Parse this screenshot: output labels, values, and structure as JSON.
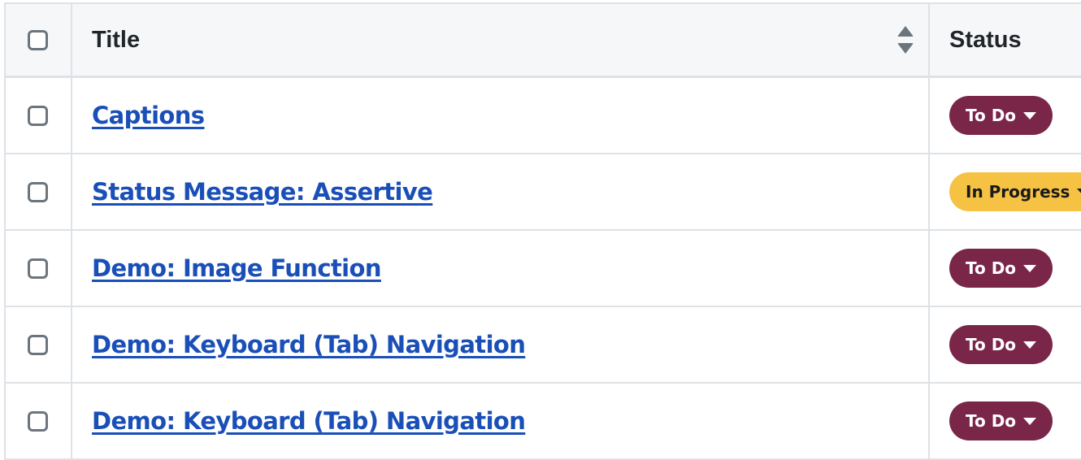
{
  "table": {
    "headers": {
      "select_all": "",
      "title": "Title",
      "status": "Status"
    },
    "sort_icon": "sort-updown-icon",
    "rows": [
      {
        "title": "Captions",
        "status": "To Do",
        "status_color": "#7a2649",
        "status_text_color": "#ffffff"
      },
      {
        "title": "Status Message: Assertive",
        "status": "In Progress",
        "status_color": "#f6c244",
        "status_text_color": "#1a1a1a"
      },
      {
        "title": "Demo: Image Function",
        "status": "To Do",
        "status_color": "#7a2649",
        "status_text_color": "#ffffff"
      },
      {
        "title": "Demo: Keyboard (Tab) Navigation",
        "status": "To Do",
        "status_color": "#7a2649",
        "status_text_color": "#ffffff"
      },
      {
        "title": "Demo: Keyboard (Tab) Navigation",
        "status": "To Do",
        "status_color": "#7a2649",
        "status_text_color": "#ffffff"
      }
    ]
  },
  "colors": {
    "link": "#1a4fb8",
    "border": "#dee2e6",
    "header_bg": "#f6f7f9"
  }
}
